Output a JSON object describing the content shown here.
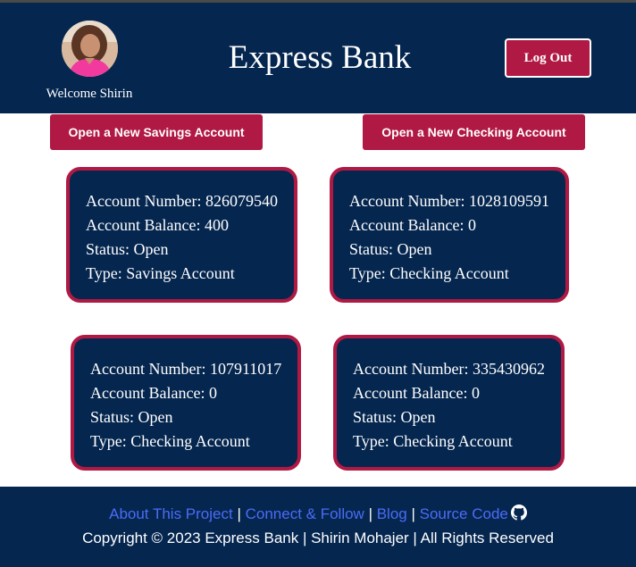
{
  "header": {
    "welcome": "Welcome Shirin",
    "brand": "Express Bank",
    "logout_label": "Log Out"
  },
  "actions": {
    "open_savings": "Open a New Savings Account",
    "open_checking": "Open a New Checking Account"
  },
  "accounts": [
    {
      "number": "Account Number: 826079540",
      "balance": "Account Balance: 400",
      "status": "Status: Open",
      "type": "Type: Savings Account"
    },
    {
      "number": "Account Number: 1028109591",
      "balance": "Account Balance: 0",
      "status": "Status: Open",
      "type": "Type: Checking Account"
    },
    {
      "number": "Account Number: 107911017",
      "balance": "Account Balance: 0",
      "status": "Status: Open",
      "type": "Type: Checking Account"
    },
    {
      "number": "Account Number: 335430962",
      "balance": "Account Balance: 0",
      "status": "Status: Open",
      "type": "Type: Checking Account"
    }
  ],
  "footer": {
    "links": [
      "About This Project",
      "Connect & Follow",
      "Blog",
      "Source Code"
    ],
    "separator": "|",
    "copyright": "Copyright © 2023 Express Bank | Shirin Mohajer | All Rights Reserved",
    "source_icon": "github-icon"
  },
  "colors": {
    "navy": "#05264f",
    "crimson": "#b01943",
    "link_blue": "#4b6cf7"
  }
}
